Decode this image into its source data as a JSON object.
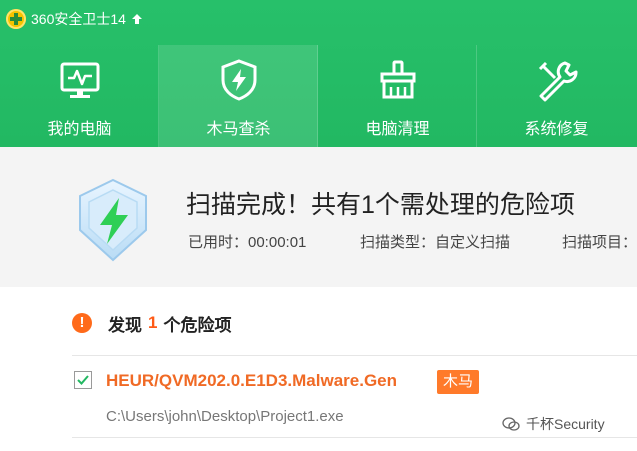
{
  "app": {
    "title": "360安全卫士14"
  },
  "nav": {
    "tabs": [
      {
        "label": "我的电脑",
        "icon": "monitor-icon",
        "active": false
      },
      {
        "label": "木马查杀",
        "icon": "shield-bolt-icon",
        "active": true
      },
      {
        "label": "电脑清理",
        "icon": "broom-icon",
        "active": false
      },
      {
        "label": "系统修复",
        "icon": "wrench-icon",
        "active": false
      }
    ]
  },
  "summary": {
    "title": "扫描完成！共有1个需处理的危险项",
    "elapsed": "已用时：00:00:01",
    "scan_type": "扫描类型：自定义扫描",
    "scan_items": "扫描项目："
  },
  "findings": {
    "prefix": "发现",
    "count": "1",
    "suffix": "个危险项",
    "items": [
      {
        "name": "HEUR/QVM202.0.E1D3.Malware.Gen",
        "badge": "木马",
        "path": "C:\\Users\\john\\Desktop\\Project1.exe",
        "checked": true
      }
    ]
  },
  "watermark": {
    "text": "千杯Security"
  },
  "colors": {
    "header_green": "#22b862",
    "threat_orange": "#f06a25",
    "badge_orange": "#ff7a2a",
    "warning_dot": "#ff6a1a"
  }
}
